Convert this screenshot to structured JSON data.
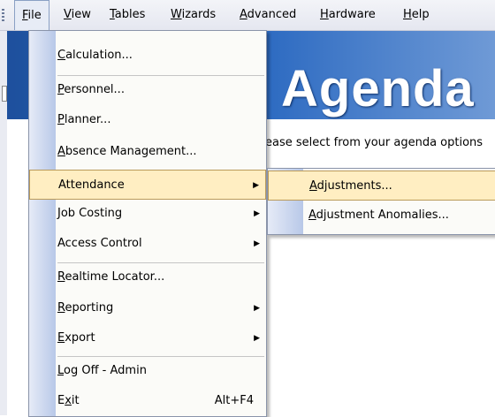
{
  "menubar": {
    "items": [
      {
        "label": "File",
        "mn": "F",
        "rest": "ile"
      },
      {
        "label": "View",
        "mn": "V",
        "rest": "iew"
      },
      {
        "label": "Tables",
        "mn": "T",
        "rest": "ables"
      },
      {
        "label": "Wizards",
        "mn": "W",
        "rest": "izards"
      },
      {
        "label": "Advanced",
        "mn": "A",
        "rest": "dvanced"
      },
      {
        "label": "Hardware",
        "mn": "H",
        "rest": "ardware"
      },
      {
        "label": "Help",
        "mn": "H",
        "rest": "elp"
      }
    ]
  },
  "background": {
    "banner_title": "Agenda",
    "subtitle": "ease select from your agenda options"
  },
  "file_menu": {
    "items": [
      {
        "pre": "",
        "mn": "C",
        "post": "alculation..."
      },
      {
        "pre": "",
        "mn": "P",
        "post": "ersonnel..."
      },
      {
        "pre": "",
        "mn": "P",
        "post": "lanner..."
      },
      {
        "pre": "",
        "mn": "A",
        "post": "bsence Management..."
      },
      {
        "pre": "",
        "mn": "",
        "post": "Attendance"
      },
      {
        "pre": "",
        "mn": "",
        "post": "Job Costing"
      },
      {
        "pre": "",
        "mn": "",
        "post": "Access Control"
      },
      {
        "pre": "",
        "mn": "R",
        "post": "ealtime Locator..."
      },
      {
        "pre": "",
        "mn": "R",
        "post": "eporting"
      },
      {
        "pre": "",
        "mn": "E",
        "post": "xport"
      },
      {
        "pre": "",
        "mn": "L",
        "post": "og Off - Admin"
      },
      {
        "pre": "E",
        "mn": "x",
        "post": "it"
      }
    ],
    "exit_shortcut": "Alt+F4"
  },
  "attendance_submenu": {
    "items": [
      {
        "mn": "A",
        "post": "djustments..."
      },
      {
        "mn": "A",
        "post": "djustment Anomalies..."
      }
    ]
  }
}
